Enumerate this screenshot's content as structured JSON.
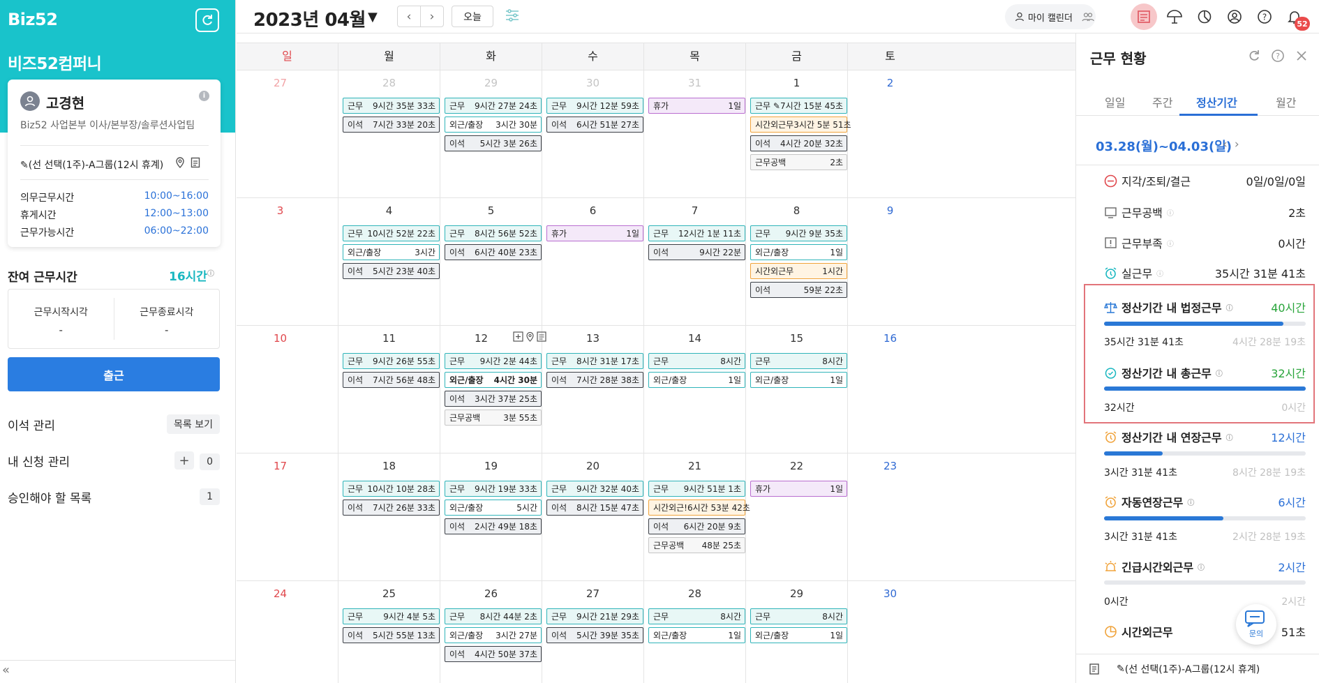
{
  "app": {
    "logo": "Biz52",
    "company": "비즈52컴퍼니"
  },
  "user": {
    "name": "고경현",
    "dept": "Biz52 사업본부 이사/본부장/솔루션사업팀",
    "schedule": "(선 선택(1주)-A그룹(12시 휴계)",
    "times": [
      {
        "label": "의무근무시간",
        "value": "10:00~16:00"
      },
      {
        "label": "휴게시간",
        "value": "12:00~13:00"
      },
      {
        "label": "근무가능시간",
        "value": "06:00~22:00"
      }
    ]
  },
  "remain": {
    "label": "잔여 근무시간",
    "value": "16시간"
  },
  "workbox": {
    "start_label": "근무시작시각",
    "end_label": "근무종료시각",
    "start": "-",
    "end": "-"
  },
  "checkin": "출근",
  "menu": {
    "away": "이석 관리",
    "away_btn": "목록 보기",
    "req": "내 신청 관리",
    "req_count": "0",
    "approve": "승인해야 할 목록",
    "approve_count": "1"
  },
  "header": {
    "month": "2023년 04월",
    "today": "오늘",
    "mycal": "마이 캘린더",
    "badge": "52"
  },
  "dow": [
    "일",
    "월",
    "화",
    "수",
    "목",
    "금",
    "토"
  ],
  "weeks": [
    {
      "days": [
        {
          "n": "27",
          "muted": true,
          "events": []
        },
        {
          "n": "28",
          "muted": true,
          "events": [
            {
              "t": "work",
              "l": "근무",
              "v": "9시간 35분 33초"
            },
            {
              "t": "away",
              "l": "이석",
              "v": "7시간 33분 20초"
            }
          ]
        },
        {
          "n": "29",
          "muted": true,
          "events": [
            {
              "t": "work",
              "l": "근무",
              "v": "9시간 27분 24초"
            },
            {
              "t": "out",
              "l": "외근/출장",
              "v": "3시간 30분"
            },
            {
              "t": "away",
              "l": "이석",
              "v": "5시간 3분 26초"
            }
          ]
        },
        {
          "n": "30",
          "muted": true,
          "events": [
            {
              "t": "work",
              "l": "근무",
              "v": "9시간 12분 59초"
            },
            {
              "t": "away",
              "l": "이석",
              "v": "6시간 51분 27초"
            }
          ]
        },
        {
          "n": "31",
          "muted": true,
          "events": [
            {
              "t": "leave",
              "l": "휴가",
              "v": "1일"
            }
          ]
        },
        {
          "n": "1",
          "events": [
            {
              "t": "work",
              "l": "근무 ✎",
              "v": "7시간 15분 45초"
            },
            {
              "t": "ot",
              "l": "시간외근무",
              "v": "3시간 5분 51초"
            },
            {
              "t": "away",
              "l": "이석",
              "v": "4시간 20분 32초"
            },
            {
              "t": "gap",
              "l": "근무공백",
              "v": "2초"
            }
          ]
        },
        {
          "n": "2",
          "events": []
        }
      ]
    },
    {
      "days": [
        {
          "n": "3",
          "events": []
        },
        {
          "n": "4",
          "events": [
            {
              "t": "work",
              "l": "근무",
              "v": "10시간 52분 22초"
            },
            {
              "t": "out",
              "l": "외근/출장",
              "v": "3시간"
            },
            {
              "t": "away",
              "l": "이석",
              "v": "5시간 23분 40초"
            }
          ]
        },
        {
          "n": "5",
          "events": [
            {
              "t": "work",
              "l": "근무",
              "v": "8시간 56분 52초"
            },
            {
              "t": "away",
              "l": "이석",
              "v": "6시간 40분 23초"
            }
          ]
        },
        {
          "n": "6",
          "events": [
            {
              "t": "leave",
              "l": "휴가",
              "v": "1일"
            }
          ]
        },
        {
          "n": "7",
          "events": [
            {
              "t": "work",
              "l": "근무",
              "v": "12시간 1분 11초"
            },
            {
              "t": "away",
              "l": "이석",
              "v": "9시간 22분"
            }
          ]
        },
        {
          "n": "8",
          "events": [
            {
              "t": "work",
              "l": "근무",
              "v": "9시간 9분 35초"
            },
            {
              "t": "out",
              "l": "외근/출장",
              "v": "1일"
            },
            {
              "t": "ot",
              "l": "시간외근무",
              "v": "1시간"
            },
            {
              "t": "away",
              "l": "이석",
              "v": "59분 22초"
            }
          ]
        },
        {
          "n": "9",
          "events": []
        }
      ]
    },
    {
      "days": [
        {
          "n": "10",
          "events": []
        },
        {
          "n": "11",
          "events": [
            {
              "t": "work",
              "l": "근무",
              "v": "9시간 26분 55초"
            },
            {
              "t": "away",
              "l": "이석",
              "v": "7시간 56분 48초"
            }
          ]
        },
        {
          "n": "12",
          "icons": true,
          "events": [
            {
              "t": "work",
              "l": "근무",
              "v": "9시간 2분 44초"
            },
            {
              "t": "out bold",
              "l": "외근/출장",
              "v": "4시간 30분"
            },
            {
              "t": "away",
              "l": "이석",
              "v": "3시간 37분 25초"
            },
            {
              "t": "gap",
              "l": "근무공백",
              "v": "3분 55초"
            }
          ]
        },
        {
          "n": "13",
          "events": [
            {
              "t": "work",
              "l": "근무",
              "v": "8시간 31분 17초"
            },
            {
              "t": "away",
              "l": "이석",
              "v": "7시간 28분 38초"
            }
          ]
        },
        {
          "n": "14",
          "events": [
            {
              "t": "work",
              "l": "근무",
              "v": "8시간"
            },
            {
              "t": "out",
              "l": "외근/출장",
              "v": "1일"
            }
          ]
        },
        {
          "n": "15",
          "events": [
            {
              "t": "work",
              "l": "근무",
              "v": "8시간"
            },
            {
              "t": "out",
              "l": "외근/출장",
              "v": "1일"
            }
          ]
        },
        {
          "n": "16",
          "events": []
        }
      ]
    },
    {
      "days": [
        {
          "n": "17",
          "events": []
        },
        {
          "n": "18",
          "events": [
            {
              "t": "work",
              "l": "근무",
              "v": "10시간 10분 28초"
            },
            {
              "t": "away",
              "l": "이석",
              "v": "7시간 26분 33초"
            }
          ]
        },
        {
          "n": "19",
          "events": [
            {
              "t": "work",
              "l": "근무",
              "v": "9시간 19분 33초"
            },
            {
              "t": "out",
              "l": "외근/출장",
              "v": "5시간"
            },
            {
              "t": "away",
              "l": "이석",
              "v": "2시간 49분 18초"
            }
          ]
        },
        {
          "n": "20",
          "events": [
            {
              "t": "work",
              "l": "근무",
              "v": "9시간 32분 40초"
            },
            {
              "t": "away",
              "l": "이석",
              "v": "8시간 15분 47초"
            }
          ]
        },
        {
          "n": "21",
          "events": [
            {
              "t": "work",
              "l": "근무",
              "v": "9시간 51분 1초"
            },
            {
              "t": "ot",
              "l": "시간외근!",
              "v": "6시간 53분 42초"
            },
            {
              "t": "away",
              "l": "이석",
              "v": "6시간 20분 9초"
            },
            {
              "t": "gap",
              "l": "근무공백",
              "v": "48분 25초"
            }
          ]
        },
        {
          "n": "22",
          "events": [
            {
              "t": "leave",
              "l": "휴가",
              "v": "1일"
            }
          ]
        },
        {
          "n": "23",
          "events": []
        }
      ]
    },
    {
      "days": [
        {
          "n": "24",
          "events": []
        },
        {
          "n": "25",
          "events": [
            {
              "t": "work",
              "l": "근무",
              "v": "9시간 4분 5초"
            },
            {
              "t": "away",
              "l": "이석",
              "v": "5시간 55분 13초"
            }
          ]
        },
        {
          "n": "26",
          "events": [
            {
              "t": "work",
              "l": "근무",
              "v": "8시간 44분 2초"
            },
            {
              "t": "out",
              "l": "외근/출장",
              "v": "3시간 27분"
            },
            {
              "t": "away",
              "l": "이석",
              "v": "4시간 50분 37초"
            }
          ]
        },
        {
          "n": "27",
          "events": [
            {
              "t": "work",
              "l": "근무",
              "v": "9시간 21분 29초"
            },
            {
              "t": "away",
              "l": "이석",
              "v": "5시간 39분 35초"
            }
          ]
        },
        {
          "n": "28",
          "events": [
            {
              "t": "work",
              "l": "근무",
              "v": "8시간"
            },
            {
              "t": "out",
              "l": "외근/출장",
              "v": "1일"
            }
          ]
        },
        {
          "n": "29",
          "events": [
            {
              "t": "work",
              "l": "근무",
              "v": "8시간"
            },
            {
              "t": "out",
              "l": "외근/출장",
              "v": "1일"
            }
          ]
        },
        {
          "n": "30",
          "events": []
        }
      ]
    }
  ],
  "panel": {
    "title": "근무 현황",
    "tabs": [
      "일일",
      "주간",
      "정산기간",
      "월간"
    ],
    "period": "03.28(월)~04.03(일)",
    "stats": [
      {
        "label": "지각/조퇴/결근",
        "value": "0일/0일/0일"
      },
      {
        "label": "근무공백",
        "value": "2초"
      },
      {
        "label": "근무부족",
        "value": "0시간"
      },
      {
        "label": "실근무",
        "value": "35시간 31분 41초"
      }
    ],
    "bars": [
      {
        "label": "정산기간 내 법정근무",
        "value": "40시간",
        "fill": 0.89,
        "left": "35시간 31분 41초",
        "right": "4시간 28분 19초"
      },
      {
        "label": "정산기간 내 총근무",
        "value": "32시간",
        "fill": 1.0,
        "left": "32시간",
        "right": "0시간"
      },
      {
        "label": "정산기간 내 연장근무",
        "value": "12시간",
        "fill": 0.29,
        "left": "3시간 31분 41초",
        "right": "8시간 28분 19초"
      },
      {
        "label": "자동연장근무",
        "value": "6시간",
        "fill": 0.59,
        "left": "3시간 31분 41초",
        "right": "2시간 28분 19초"
      },
      {
        "label": "긴급시간외근무",
        "value": "2시간",
        "fill": 0,
        "left": "0시간",
        "right": "2시간"
      },
      {
        "label": "시간외근무",
        "value": "51초"
      }
    ],
    "chat": "문의",
    "footer": "(선 선택(1주)-A그룹(12시 휴계)"
  },
  "colors": {
    "teal": "#19c3cb",
    "blue": "#2a7de1",
    "red_highlight": "#e2747a"
  }
}
